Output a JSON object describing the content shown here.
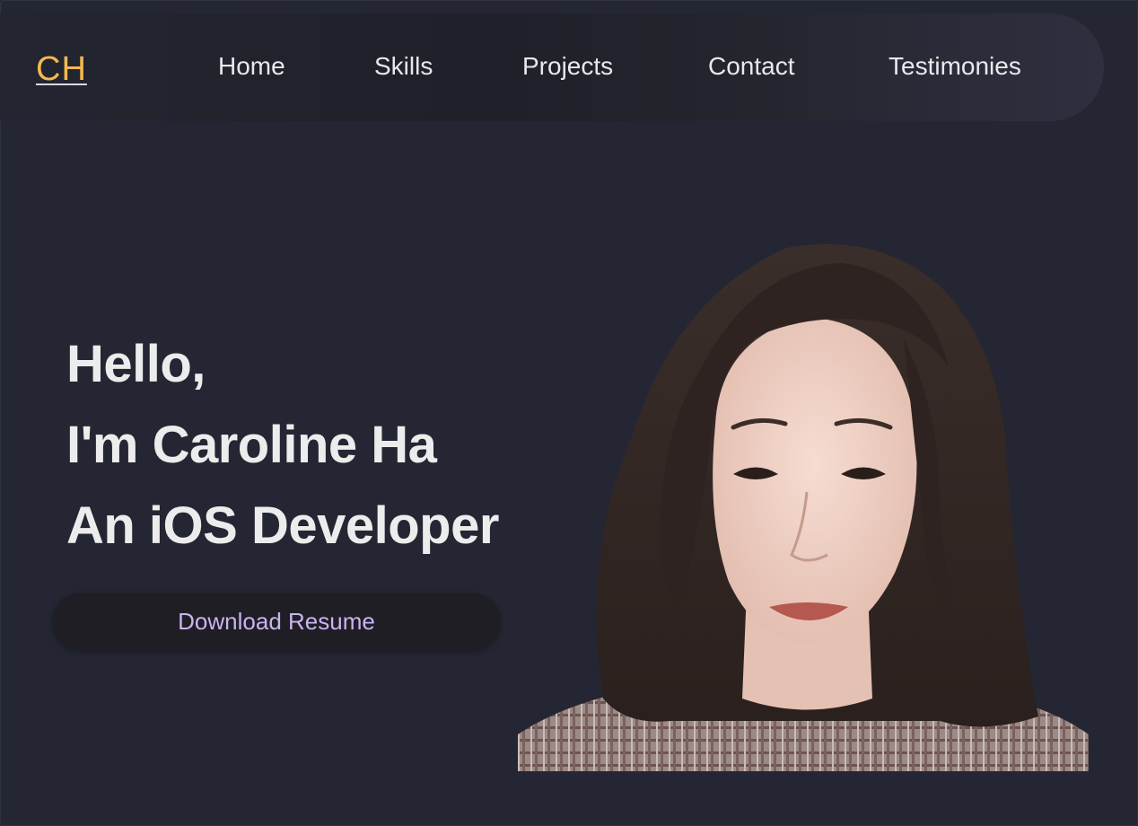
{
  "logo": {
    "text": "CH"
  },
  "nav": {
    "items": [
      {
        "label": "Home"
      },
      {
        "label": "Skills"
      },
      {
        "label": "Projects"
      },
      {
        "label": "Contact"
      },
      {
        "label": "Testimonies"
      }
    ]
  },
  "hero": {
    "line1": "Hello,",
    "line2": "I'm Caroline Ha",
    "line3": "An iOS Developer",
    "button_label": "Download Resume"
  },
  "colors": {
    "background": "#242633",
    "logo": "#f2b94f",
    "button_text": "#c9b4ef",
    "button_bg": "#1f1e25"
  }
}
